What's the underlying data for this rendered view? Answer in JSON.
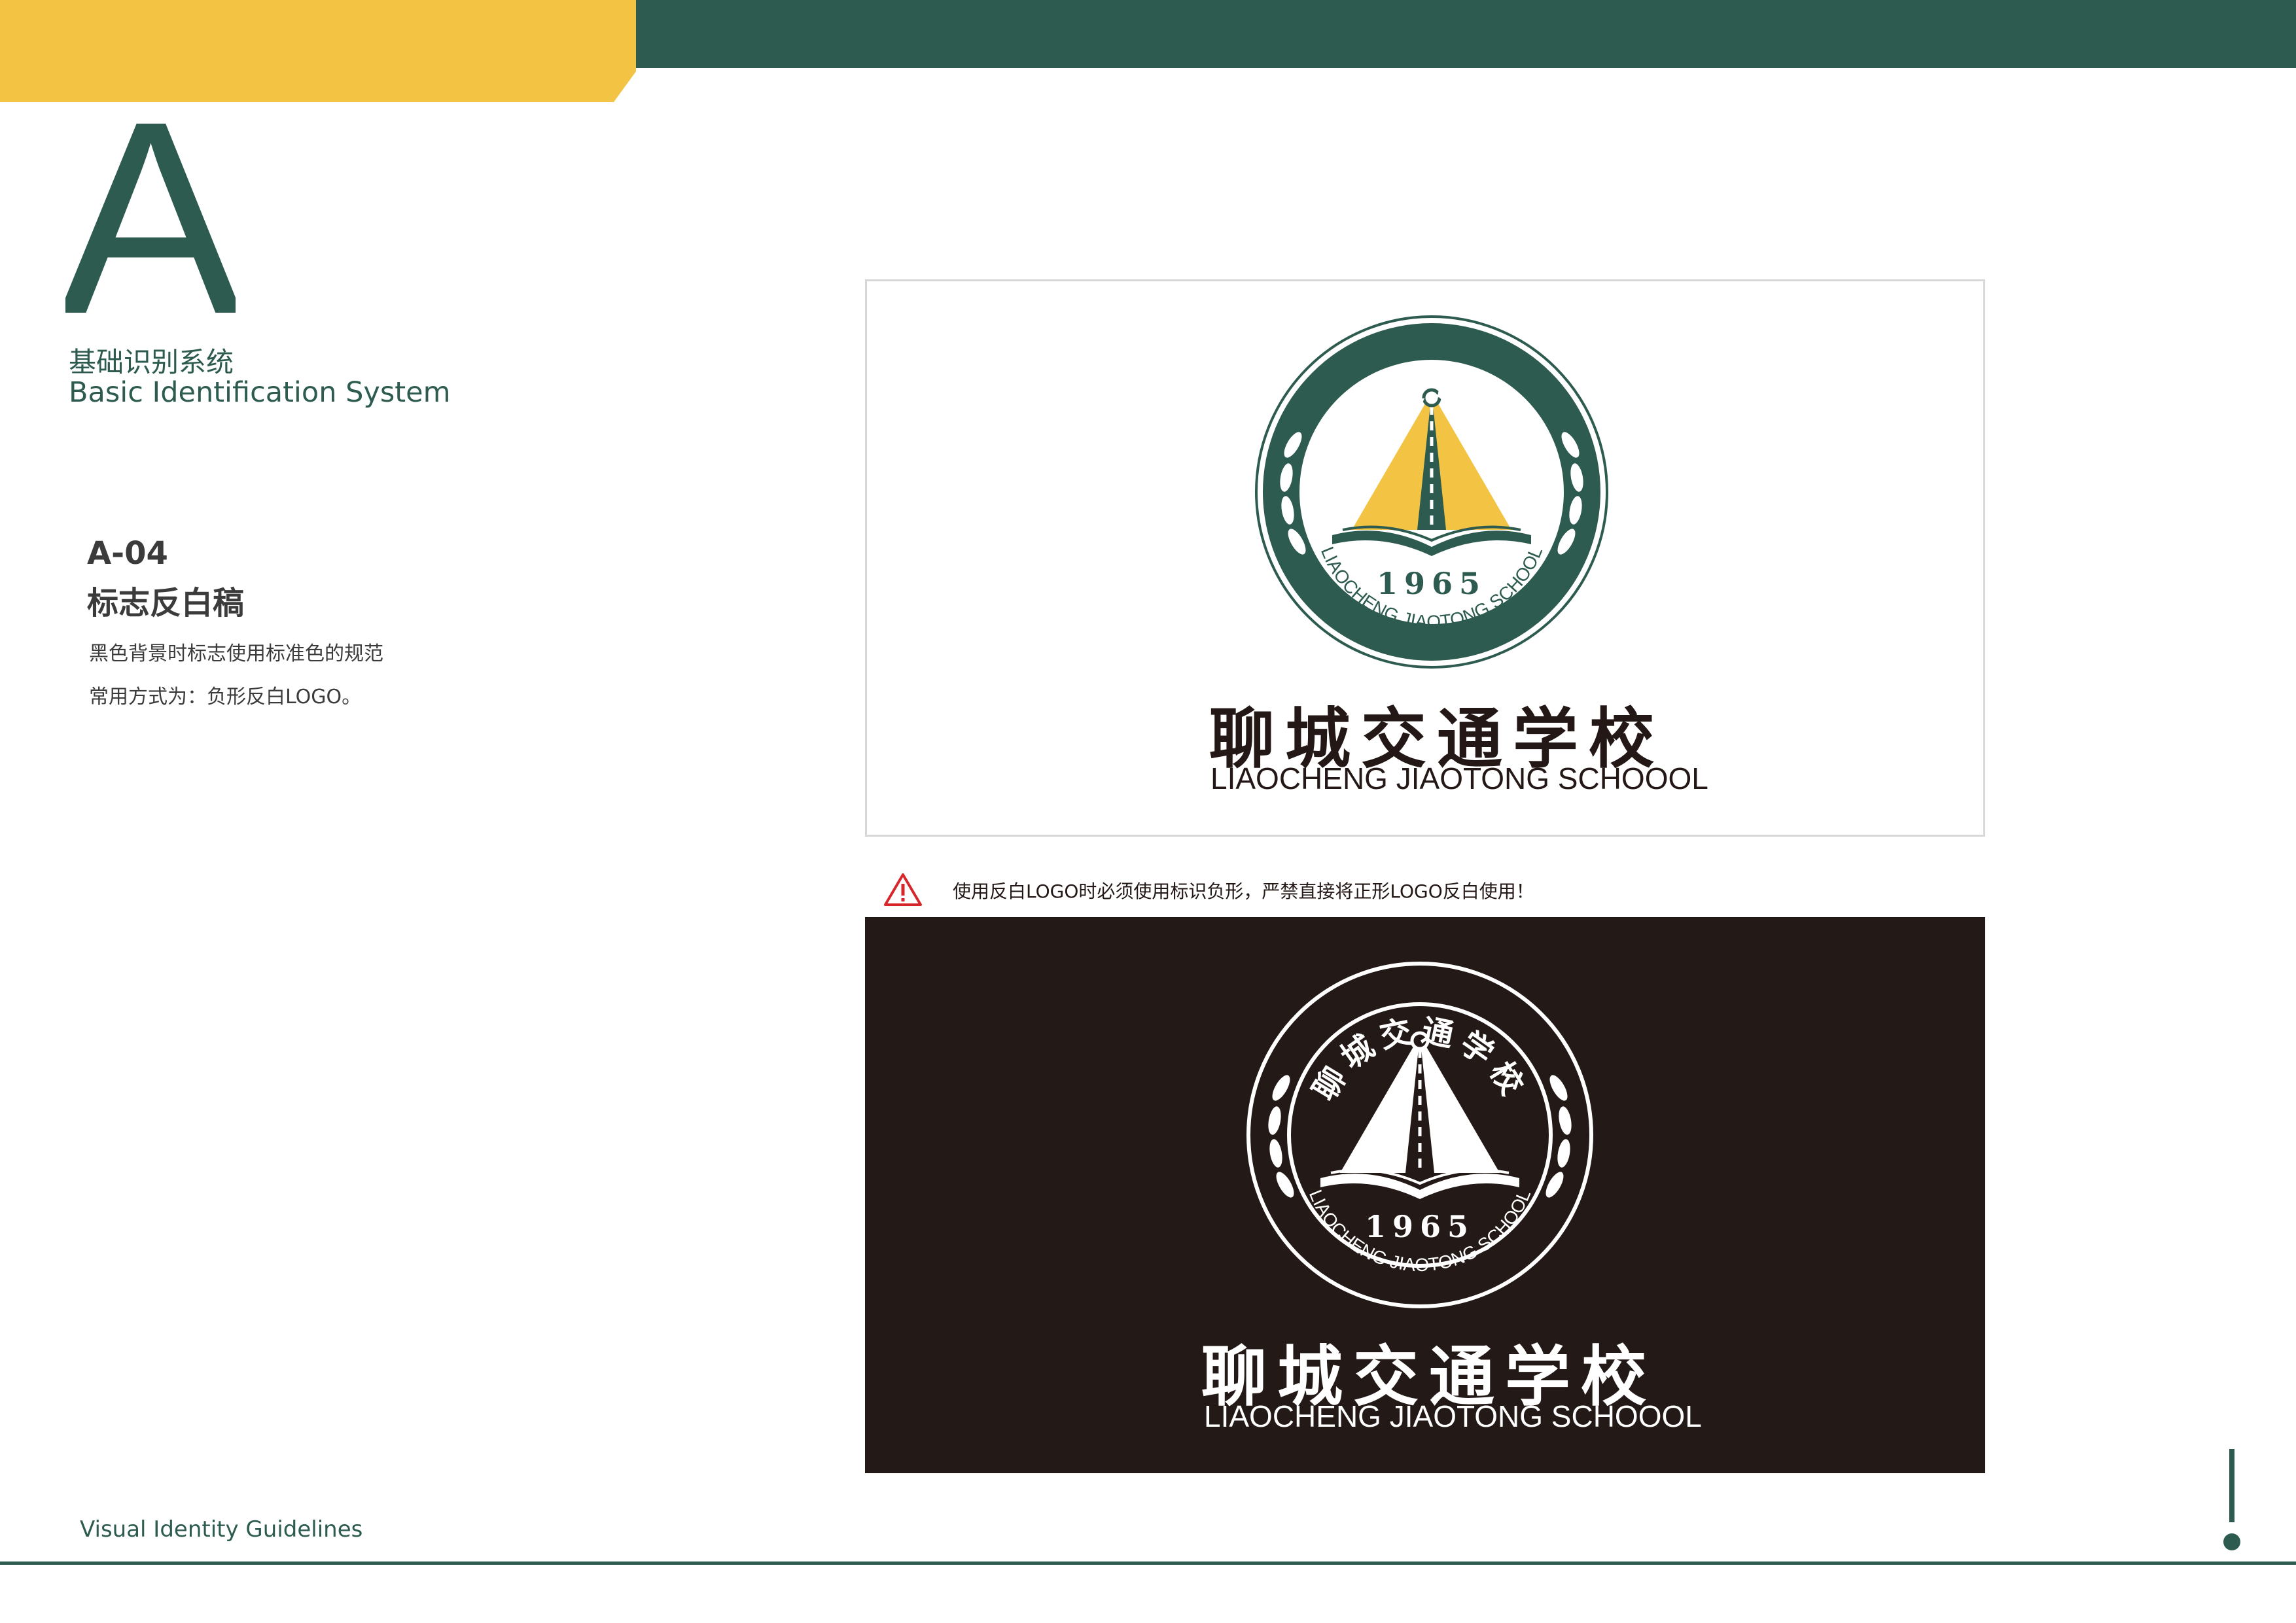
{
  "header": {
    "accent_yellow": "#f3c343",
    "accent_green": "#2e5b4f"
  },
  "section": {
    "letter": "A",
    "title_cn": "基础识别系统",
    "title_en": "Basic Identification System"
  },
  "page": {
    "code": "A-04",
    "title": "标志反白稿",
    "desc_line1": "黑色背景时标志使用标准色的规范",
    "desc_line2": "常用方式为：负形反白LOGO。"
  },
  "logo": {
    "name_cn": "聊城交通学校",
    "name_en": "LIAOCHENG JIAOTONG SCHOOOL",
    "year": "1965",
    "ring_text_en": "LIAOCHENG JIAOTONG SCHOOL",
    "colors": {
      "green": "#2e5b4f",
      "yellow": "#f3c343",
      "dark": "#231917"
    }
  },
  "warning": {
    "icon": "warning-triangle-icon",
    "text": "使用反白LOGO时必须使用标识负形，严禁直接将正形LOGO反白使用！"
  },
  "footer": {
    "title": "Visual Identity Guidelines",
    "mark": "exclamation-mark-icon"
  }
}
